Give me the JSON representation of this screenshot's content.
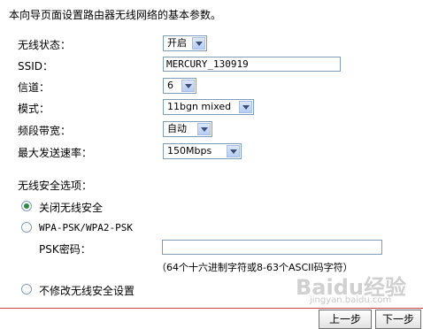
{
  "intro": "本向导页面设置路由器无线网络的基本参数。",
  "fields": {
    "wireless_status": {
      "label": "无线状态：",
      "value": "开启"
    },
    "ssid": {
      "label": "SSID：",
      "value": "MERCURY_130919"
    },
    "channel": {
      "label": "信道：",
      "value": "6"
    },
    "mode": {
      "label": "模式：",
      "value": "11bgn mixed"
    },
    "bandwidth": {
      "label": "频段带宽：",
      "value": "自动"
    },
    "max_rate": {
      "label": "最大发送速率：",
      "value": "150Mbps"
    }
  },
  "security": {
    "section_label": "无线安全选项：",
    "options": [
      {
        "label": "关闭无线安全",
        "selected": true
      },
      {
        "label": "WPA-PSK/WPA2-PSK",
        "selected": false
      },
      {
        "label": "不修改无线安全设置",
        "selected": false
      }
    ],
    "psk_label": "PSK密码：",
    "psk_value": "",
    "psk_hint": "（64个十六进制字符或8-63个ASCII码字符）"
  },
  "buttons": {
    "prev": "上一步",
    "next": "下一步"
  },
  "watermark": {
    "brand": "Baidu经验",
    "sub": "jingyan.baidu.com"
  }
}
